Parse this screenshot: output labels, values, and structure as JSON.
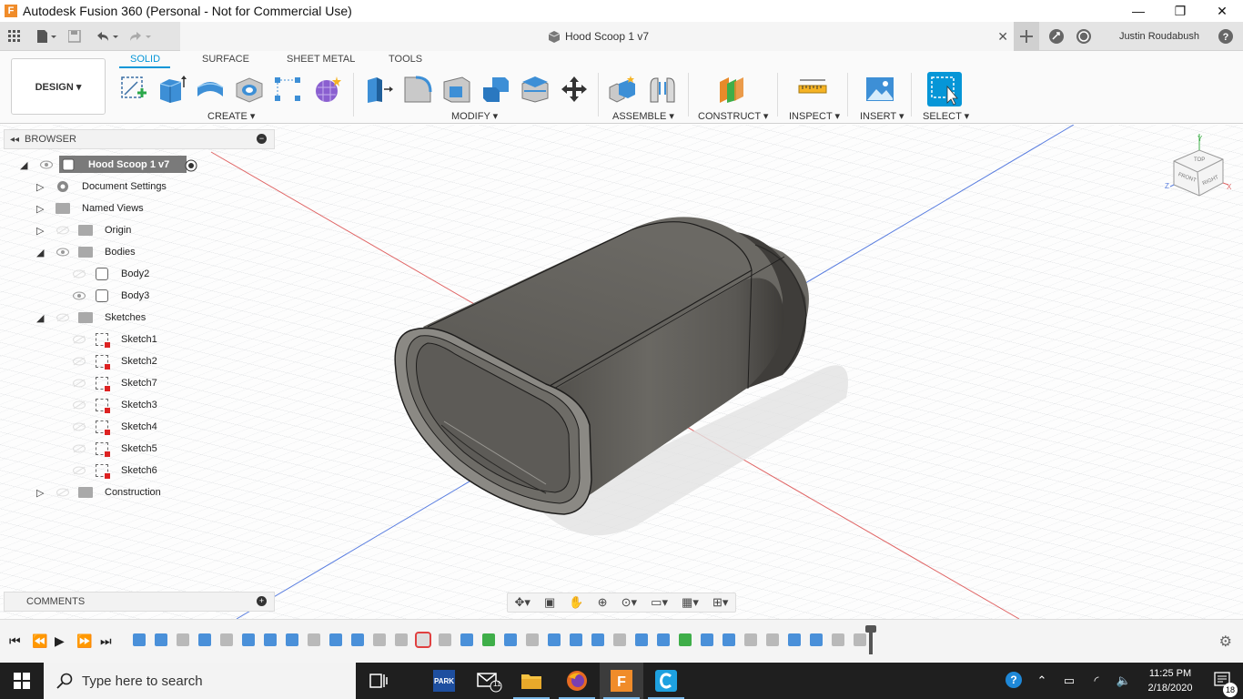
{
  "window": {
    "title": "Autodesk Fusion 360 (Personal - Not for Commercial Use)",
    "logo_letter": "F",
    "min": "—",
    "max": "❐",
    "close": "✕"
  },
  "qat": {
    "doc_title": "Hood Scoop 1 v7",
    "tab_close": "✕",
    "user_name": "Justin Roudabush",
    "help": "?"
  },
  "ribbon": {
    "workspace": "DESIGN ▾",
    "tabs": [
      "SOLID",
      "SURFACE",
      "SHEET METAL",
      "TOOLS"
    ],
    "groups": {
      "create": "CREATE ▾",
      "modify": "MODIFY ▾",
      "assemble": "ASSEMBLE ▾",
      "construct": "CONSTRUCT ▾",
      "inspect": "INSPECT ▾",
      "insert": "INSERT ▾",
      "select": "SELECT ▾"
    }
  },
  "browser": {
    "header": "BROWSER",
    "root": "Hood Scoop 1 v7",
    "items": [
      {
        "label": "Document Settings"
      },
      {
        "label": "Named Views"
      },
      {
        "label": "Origin"
      },
      {
        "label": "Bodies"
      },
      {
        "label": "Body2"
      },
      {
        "label": "Body3"
      },
      {
        "label": "Sketches"
      },
      {
        "label": "Sketch1"
      },
      {
        "label": "Sketch2"
      },
      {
        "label": "Sketch7"
      },
      {
        "label": "Sketch3"
      },
      {
        "label": "Sketch4"
      },
      {
        "label": "Sketch5"
      },
      {
        "label": "Sketch6"
      },
      {
        "label": "Construction"
      }
    ]
  },
  "comments": {
    "label": "COMMENTS"
  },
  "viewcube": {
    "top": "TOP",
    "front": "FRONT",
    "right": "RIGHT",
    "axis_x": "X",
    "axis_y": "Y",
    "axis_z": "Z"
  },
  "taskbar": {
    "search_placeholder": "Type here to search",
    "mail_badge": "11",
    "time": "11:25 PM",
    "date": "2/18/2020",
    "notif_count": "18"
  },
  "colors": {
    "accent": "#0696d7",
    "body": "#5c5a56",
    "taskbar": "#1f1f1f"
  }
}
